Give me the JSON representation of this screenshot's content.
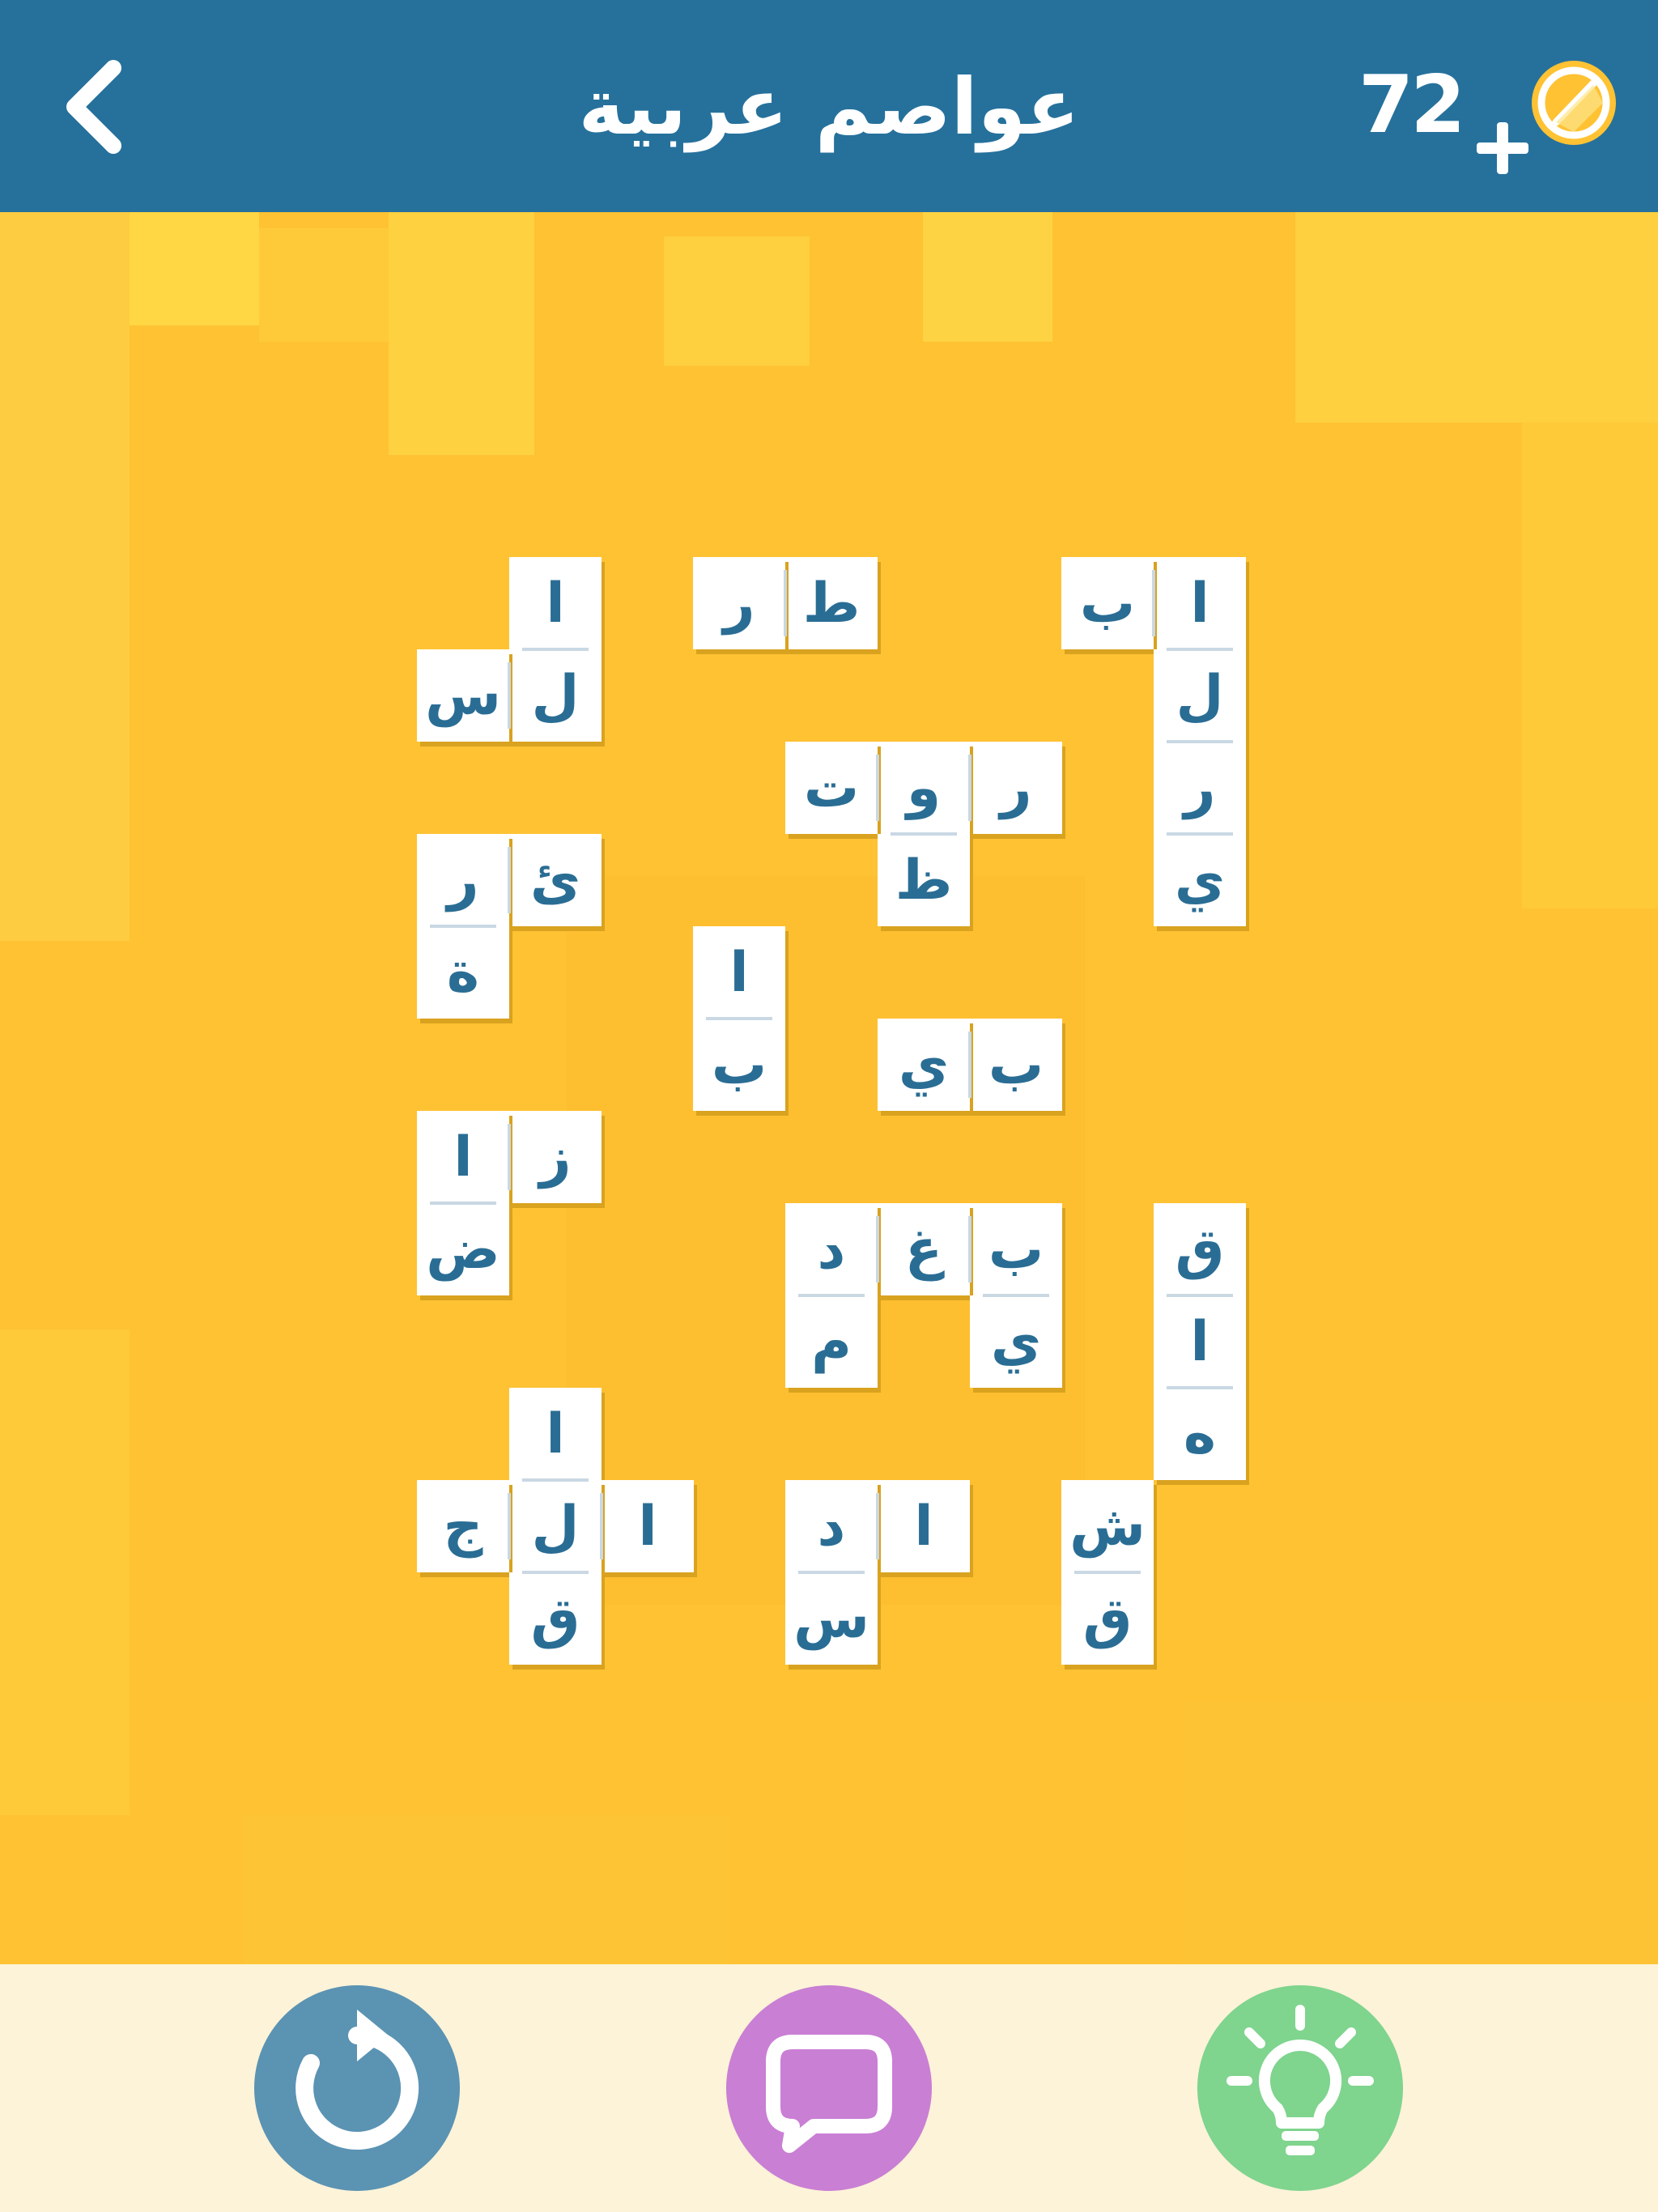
{
  "header": {
    "title": "عواصم عربية",
    "coins": "72",
    "back_icon": "chevron-left-icon",
    "coin_icon": "coin-icon",
    "add_icon": "plus-icon"
  },
  "colors": {
    "header": "#26719c",
    "board": "#fec233",
    "tile": "#ffffff",
    "letter": "#2a6d94",
    "footer": "#fdf3d8",
    "restart": "#5b93b3",
    "chat": "#c97fd4",
    "hint": "#7fd48e"
  },
  "board": {
    "groups": [
      {
        "id": "g1",
        "tiles": [
          {
            "ch": "ا"
          },
          {
            "ch": "ل"
          },
          {
            "ch": "س"
          }
        ]
      },
      {
        "id": "g2",
        "tiles": [
          {
            "ch": "ط"
          },
          {
            "ch": "ر"
          }
        ]
      },
      {
        "id": "g3",
        "tiles": [
          {
            "ch": "ا"
          },
          {
            "ch": "ب"
          },
          {
            "ch": "ل"
          },
          {
            "ch": "ر"
          },
          {
            "ch": "ي"
          }
        ]
      },
      {
        "id": "g4",
        "tiles": [
          {
            "ch": "ر"
          },
          {
            "ch": "و"
          },
          {
            "ch": "ت"
          },
          {
            "ch": "ظ"
          }
        ]
      },
      {
        "id": "g5",
        "tiles": [
          {
            "ch": "ئ"
          },
          {
            "ch": "ر"
          },
          {
            "ch": "ة"
          }
        ]
      },
      {
        "id": "g6",
        "tiles": [
          {
            "ch": "ا"
          },
          {
            "ch": "ب"
          }
        ]
      },
      {
        "id": "g7",
        "tiles": [
          {
            "ch": "ب"
          },
          {
            "ch": "ي"
          }
        ]
      },
      {
        "id": "g8",
        "tiles": [
          {
            "ch": "ز"
          },
          {
            "ch": "ا"
          },
          {
            "ch": "ض"
          }
        ]
      },
      {
        "id": "g9",
        "tiles": [
          {
            "ch": "ب"
          },
          {
            "ch": "غ"
          },
          {
            "ch": "د"
          },
          {
            "ch": "ي"
          },
          {
            "ch": "م"
          }
        ]
      },
      {
        "id": "g10",
        "tiles": [
          {
            "ch": "ق"
          },
          {
            "ch": "ا"
          },
          {
            "ch": "ه"
          }
        ]
      },
      {
        "id": "g11",
        "tiles": [
          {
            "ch": "ا"
          },
          {
            "ch": "ا"
          },
          {
            "ch": "ل"
          },
          {
            "ch": "ج"
          },
          {
            "ch": "ق"
          }
        ]
      },
      {
        "id": "g12",
        "tiles": [
          {
            "ch": "ا"
          },
          {
            "ch": "د"
          },
          {
            "ch": "س"
          }
        ]
      },
      {
        "id": "g13",
        "tiles": [
          {
            "ch": "ش"
          },
          {
            "ch": "ق"
          }
        ]
      }
    ]
  },
  "footer": {
    "restart_icon": "restart-icon",
    "chat_icon": "chat-icon",
    "hint_icon": "lightbulb-icon"
  }
}
